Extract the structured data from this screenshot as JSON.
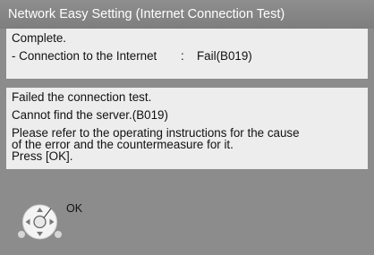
{
  "title": "Network Easy Setting (Internet Connection Test)",
  "result": {
    "status": "Complete.",
    "item_label": "- Connection to the Internet",
    "separator": ":",
    "item_value": "Fail(B019)"
  },
  "message": {
    "line1": "Failed the connection test.",
    "line2": "Cannot find the server.(B019)",
    "line3": "Please refer to the operating instructions for the cause\nof the error and the countermeasure for it.\nPress [OK]."
  },
  "footer": {
    "ok_label": "OK",
    "ok_icon": "remote-dpad-ok-icon"
  }
}
